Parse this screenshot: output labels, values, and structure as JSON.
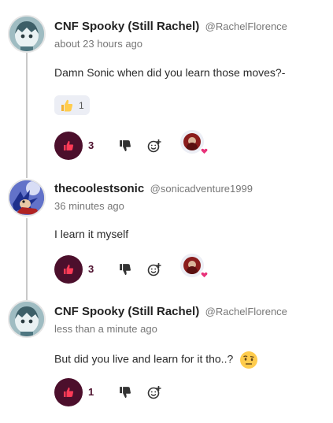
{
  "comments": [
    {
      "author": "CNF Spooky (Still Rachel)",
      "handle": "@RachelFlorence",
      "time": "about 23 hours ago",
      "text": "Damn Sonic when did you learn those moves?-",
      "reaction": {
        "icon": "thumbs-up-emoji",
        "count": "1"
      },
      "likes": "3",
      "liked_by_avatar": true
    },
    {
      "author": "thecoolestsonic",
      "handle": "@sonicadventure1999",
      "time": "36 minutes ago",
      "text": "I learn it myself",
      "likes": "3",
      "liked_by_avatar": true
    },
    {
      "author": "CNF Spooky (Still Rachel)",
      "handle": "@RachelFlorence",
      "time": "less than a minute ago",
      "text": "But did you live and learn for it tho..?",
      "text_emoji": "raised-eyebrow-emoji",
      "likes": "1",
      "liked_by_avatar": false
    }
  ],
  "colors": {
    "accent": "#4c0f2c",
    "heart": "#e8337a",
    "chip_bg": "#eceef5"
  }
}
